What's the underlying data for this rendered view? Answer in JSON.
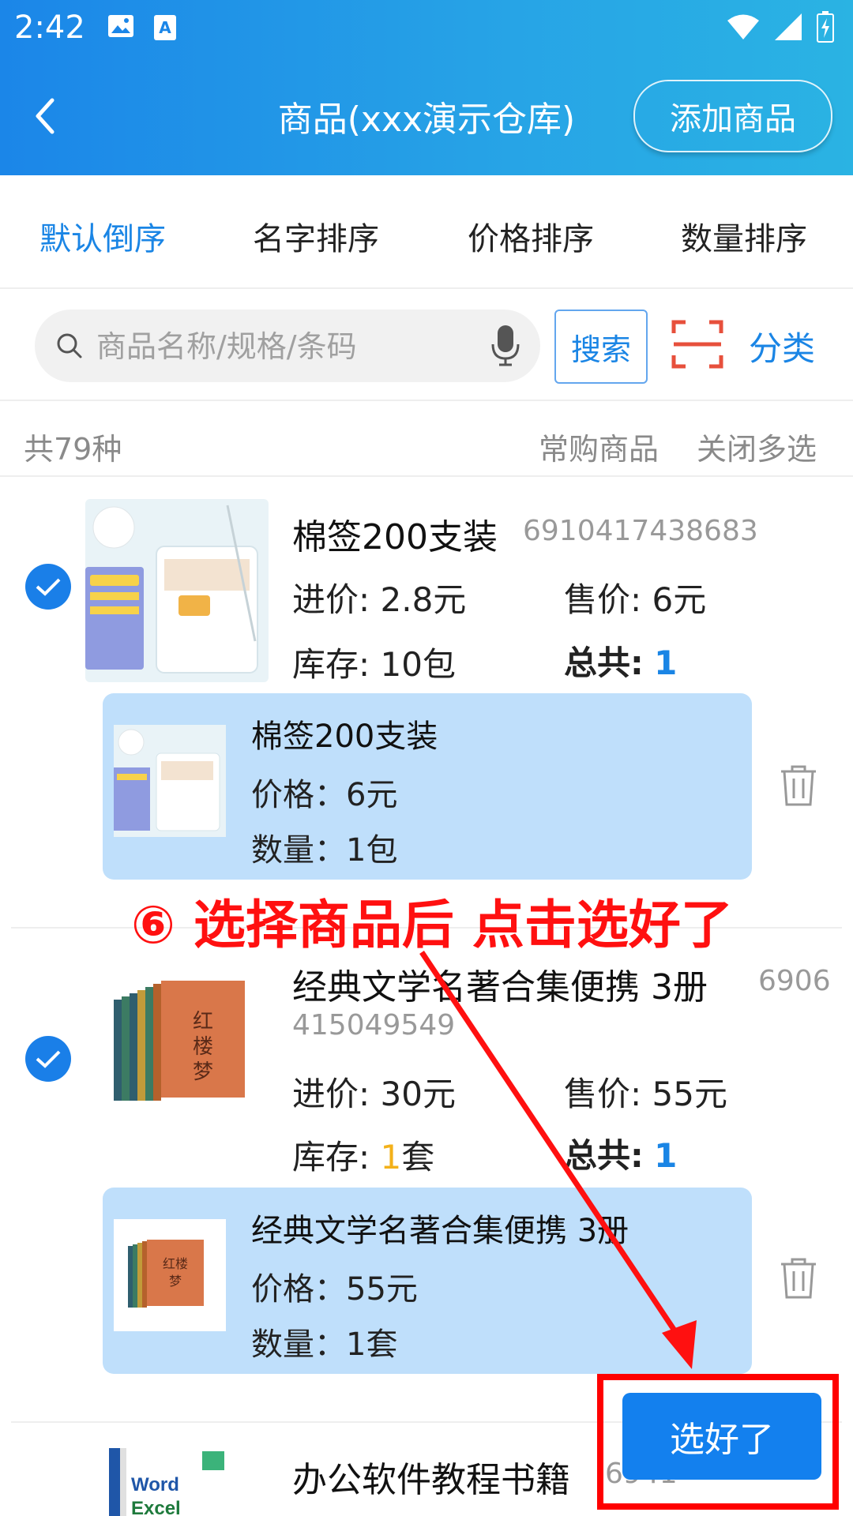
{
  "status": {
    "time": "2:42"
  },
  "header": {
    "title": "商品(xxx演示仓库)",
    "add_button": "添加商品"
  },
  "sort_tabs": [
    {
      "label": "默认倒序",
      "active": true
    },
    {
      "label": "名字排序",
      "active": false
    },
    {
      "label": "价格排序",
      "active": false
    },
    {
      "label": "数量排序",
      "active": false
    }
  ],
  "search": {
    "placeholder": "商品名称/规格/条码",
    "button": "搜索",
    "category": "分类"
  },
  "summary": {
    "count": "共79种",
    "frequent": "常购商品",
    "close_multi": "关闭多选"
  },
  "products": [
    {
      "name": "棉签200支装",
      "code": "6910417438683",
      "purchase_label": "进价:",
      "purchase_value": "2.8元",
      "sale_label": "售价:",
      "sale_value": "6元",
      "stock_label": "库存:",
      "stock_num": "10",
      "stock_unit": "包",
      "total_label": "总共:",
      "total_value": "1",
      "selected": true,
      "cart": {
        "name": "棉签200支装",
        "price": "价格：6元",
        "qty": "数量：1包"
      }
    },
    {
      "name": "经典文学名著合集便携  3册",
      "code_line1": "6906",
      "code_line2": "415049549",
      "purchase_label": "进价:",
      "purchase_value": "30元",
      "sale_label": "售价:",
      "sale_value": "55元",
      "stock_label": "库存:",
      "stock_num": "1",
      "stock_unit": "套",
      "total_label": "总共:",
      "total_value": "1",
      "selected": true,
      "cart": {
        "name": "经典文学名著合集便携 3册",
        "price": "价格：55元",
        "qty": "数量：1套"
      }
    },
    {
      "name": "办公软件教程书籍",
      "code_partial": "6941"
    }
  ],
  "annotation": "⑥ 选择商品后 点击选好了",
  "confirm_button": "选好了",
  "colors": {
    "accent": "#1a85e5",
    "header_start": "#1b86e8",
    "header_end": "#2ab3e3",
    "annotation": "#ff1010"
  }
}
